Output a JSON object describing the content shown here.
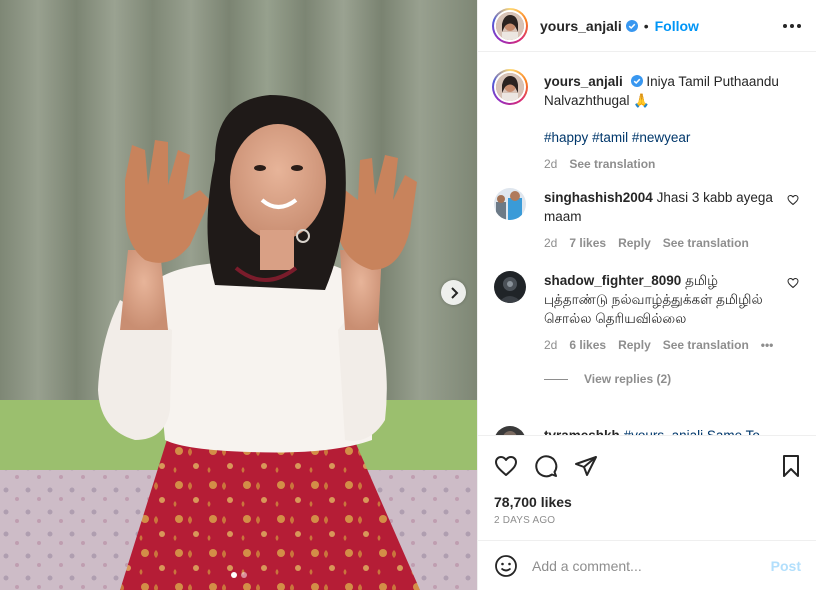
{
  "post": {
    "username": "yours_anjali",
    "follow_label": "Follow",
    "separator": "•",
    "caption_text": "Iniya Tamil Puthaandu Nalvazhthugal 🙏",
    "hashtags": [
      "#happy",
      "#tamil",
      "#newyear"
    ],
    "caption_time": "2d",
    "see_translation": "See translation",
    "likes": "78,700 likes",
    "posted_ago": "2 days ago"
  },
  "comments": [
    {
      "username": "singhashish2004",
      "text": "Jhasi 3 kabb ayega maam",
      "time": "2d",
      "likes": "7 likes",
      "reply": "Reply",
      "translate": "See translation"
    },
    {
      "username": "shadow_fighter_8090",
      "text": "தமிழ் புத்தாண்டு நல்வாழ்த்துக்கள் தமிழில் சொல்ல தெரியவில்லை",
      "time": "2d",
      "likes": "6 likes",
      "reply": "Reply",
      "translate": "See translation",
      "more": "•••",
      "view_replies": "View replies (2)"
    },
    {
      "username": "tvrameshkh",
      "text": "#yours_anjali Same To..."
    }
  ],
  "composer": {
    "placeholder": "Add a comment...",
    "post_label": "Post"
  },
  "colors": {
    "accent": "#0095f6",
    "muted": "#8e8e8e",
    "hashtag": "#00376b",
    "post_disabled": "#b2dffc"
  },
  "icons": [
    "verified-icon",
    "more-options-icon",
    "heart-icon",
    "comment-icon",
    "share-icon",
    "bookmark-icon",
    "emoji-icon",
    "chevron-right-icon"
  ]
}
